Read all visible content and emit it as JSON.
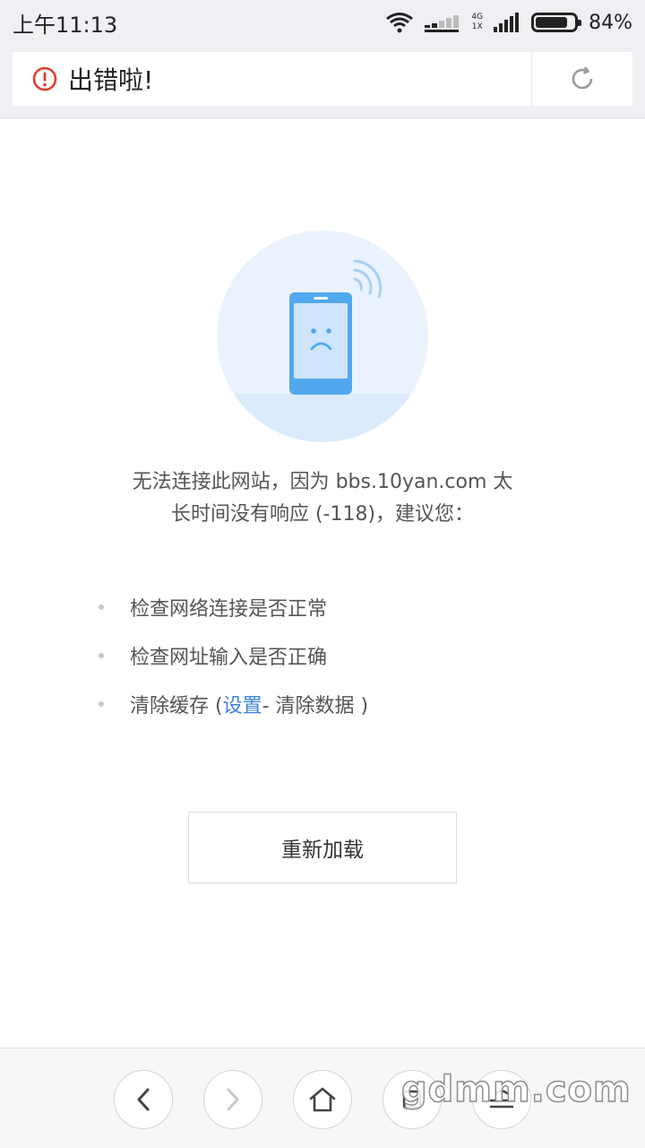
{
  "status_bar": {
    "time": "上午11:13",
    "network_top": "4G",
    "network_bottom": "1X",
    "battery_percent": "84%",
    "battery_level": 0.84
  },
  "address_bar": {
    "title": "出错啦!"
  },
  "error": {
    "message_line1": "无法连接此网站，因为 bbs.10yan.com 太",
    "message_line2": "长时间没有响应 (-118)，建议您：",
    "suggestions": [
      {
        "text": "检查网络连接是否正常"
      },
      {
        "text": "检查网址输入是否正确"
      },
      {
        "prefix": "清除缓存 ( ",
        "link": "设置",
        "suffix": " - 清除数据 )"
      }
    ]
  },
  "reload_button": {
    "label": "重新加载"
  },
  "watermark": "gdmm.com",
  "colors": {
    "error_icon": "#e03c2c",
    "link": "#3a83d9",
    "illustration_circle": "#eaf3fd",
    "phone_blue": "#52a8ee"
  },
  "icons": {
    "title_icon": "error-circle-icon",
    "reload": "reload-icon",
    "back": "chevron-left-icon",
    "forward": "chevron-right-icon",
    "home": "home-icon",
    "menu": "menu-icon"
  }
}
